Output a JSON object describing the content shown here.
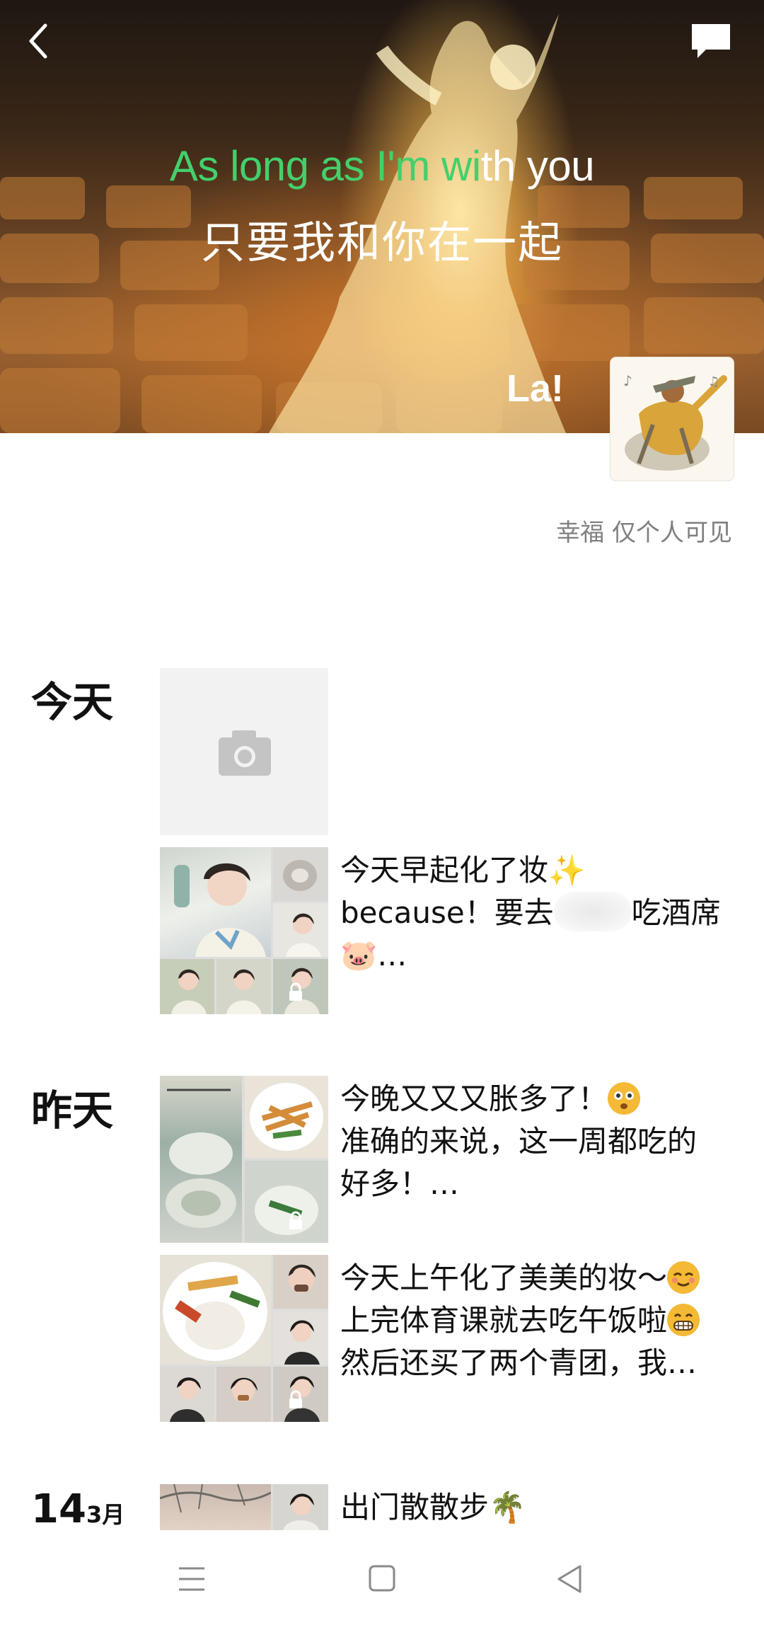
{
  "cover": {
    "lyric_en_highlight": "As long as I'm wi",
    "lyric_en_rest": "th you",
    "lyric_cn": "只要我和你在一起",
    "overlay_text": "La!",
    "colors": {
      "lyric_highlight": "#43d06b",
      "lyric_text": "#ffffff"
    }
  },
  "profile": {
    "signature": "幸福 仅个人可见"
  },
  "timeline": {
    "today": {
      "label": "今天",
      "posts": [
        {
          "text_line1": "今天早起化了妆✨",
          "text_line2a": "because！要去",
          "text_line2b": "吃酒席",
          "text_line3": "🐷…"
        }
      ]
    },
    "yesterday": {
      "label": "昨天",
      "posts": [
        {
          "text_line1": "今晚又又又胀多了！",
          "text_line2": "准确的来说，这一周都吃的",
          "text_line3": "好多！…"
        },
        {
          "text_line1": "今天上午化了美美的妆～",
          "text_line2": "上完体育课就去吃午饭啦",
          "text_line3": "然后还买了两个青团，我…"
        }
      ]
    },
    "march14": {
      "day": "14",
      "month": "3月",
      "posts": [
        {
          "text_line1": "出门散散步🌴"
        }
      ]
    }
  },
  "icons": [
    "back-icon",
    "comment-icon",
    "camera-icon",
    "lock-icon",
    "menu-icon",
    "home-icon",
    "back-triangle-icon"
  ]
}
